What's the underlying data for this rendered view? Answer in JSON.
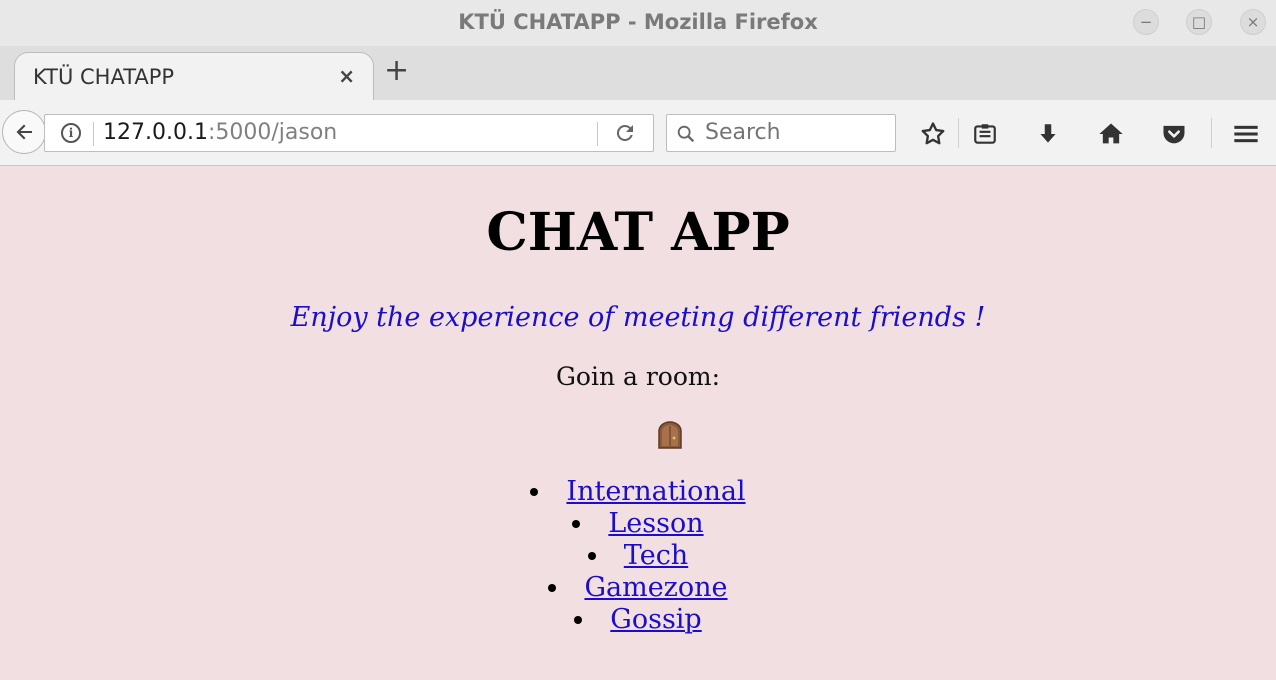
{
  "window": {
    "title": "KTÜ CHATAPP - Mozilla Firefox",
    "controls": {
      "minimize": "−",
      "maximize": "□",
      "close": "×"
    }
  },
  "tabs": [
    {
      "title": "KTÜ CHATAPP",
      "close": "×",
      "active": true
    }
  ],
  "new_tab_label": "+",
  "navbar": {
    "url_host": "127.0.0.1",
    "url_rest": ":5000/jason",
    "search_placeholder": "Search",
    "icons": [
      "back-icon",
      "info-icon",
      "reload-icon",
      "search-icon",
      "bookmark-star-icon",
      "reading-list-icon",
      "download-icon",
      "home-icon",
      "pocket-icon",
      "menu-icon"
    ]
  },
  "page": {
    "title": "CHAT APP",
    "tagline": "Enjoy the experience of meeting different friends !",
    "prompt": "Goin a room:",
    "door_icon": "door-icon",
    "rooms": [
      {
        "label": "International"
      },
      {
        "label": "Lesson"
      },
      {
        "label": "Tech"
      },
      {
        "label": "Gamezone"
      },
      {
        "label": "Gossip"
      }
    ],
    "colors": {
      "background": "#f1dfe2",
      "link": "#1a0dcc",
      "tagline": "#1a0dcc"
    }
  }
}
